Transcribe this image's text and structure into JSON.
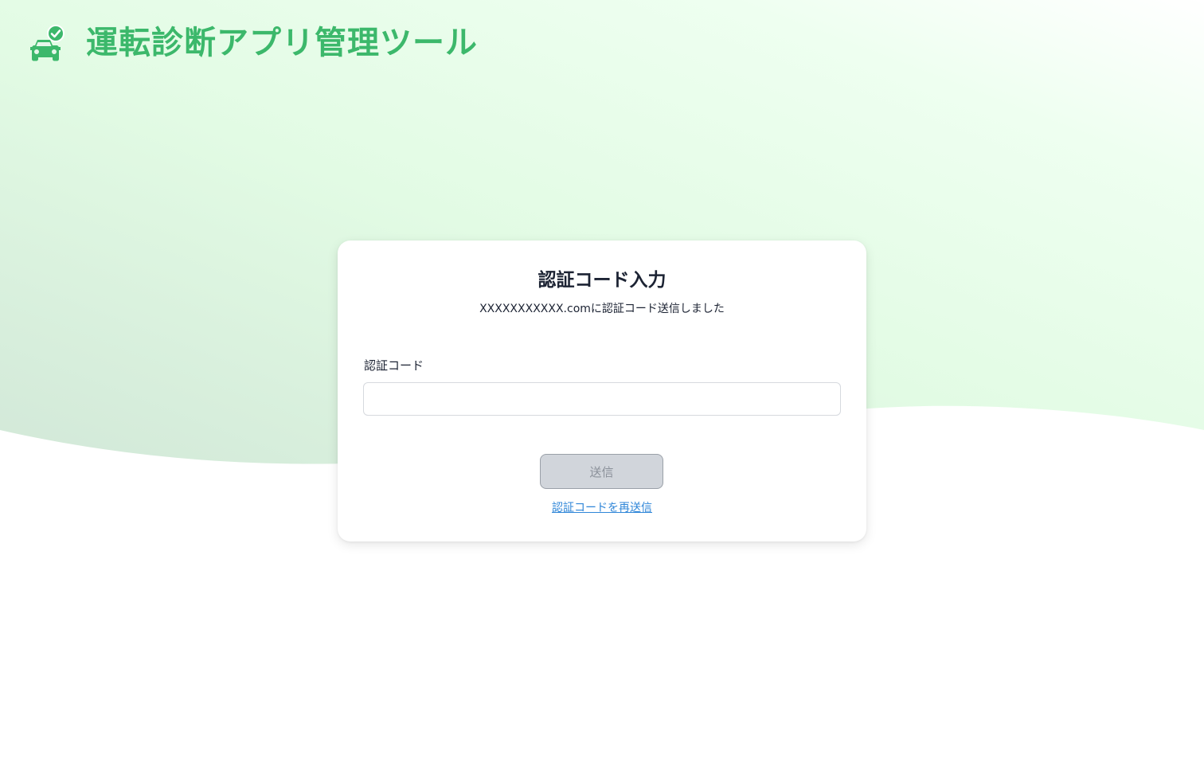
{
  "header": {
    "logo_icon": "car-check-icon",
    "title": "運転診断アプリ管理ツール",
    "title_color": "#3cb86b"
  },
  "form": {
    "title": "認証コード入力",
    "subtitle": "XXXXXXXXXXX.comに認証コード送信しました",
    "code_label": "認証コード",
    "code_value": "",
    "code_placeholder": "",
    "submit_label": "送信",
    "submit_disabled": true,
    "resend_label": "認証コードを再送信"
  },
  "theme": {
    "accent": "#3cb86b",
    "link": "#2f86d8",
    "button_disabled_bg": "#d1d5db",
    "background_gradient_from": "#cfe8d6",
    "background_gradient_to": "#e9ffe9"
  }
}
